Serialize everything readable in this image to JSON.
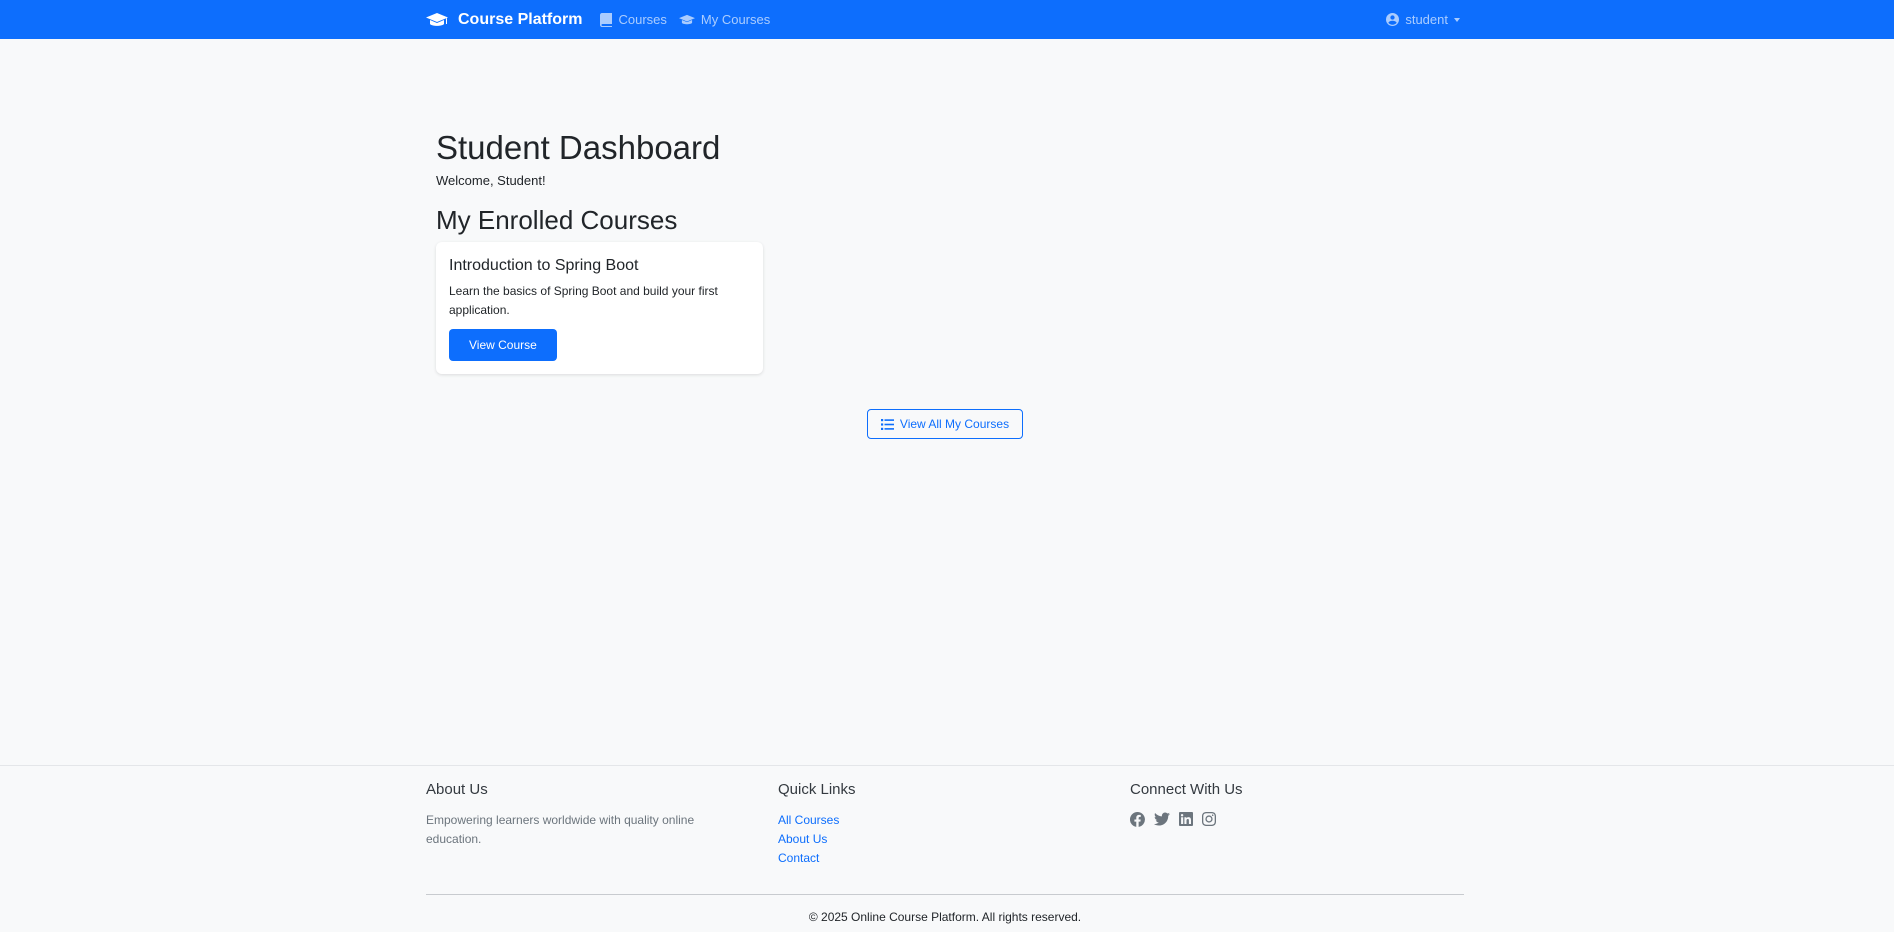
{
  "navbar": {
    "brand": "Course Platform",
    "links": [
      {
        "label": "Courses",
        "icon": "book-icon"
      },
      {
        "label": "My Courses",
        "icon": "graduation-cap-icon"
      }
    ],
    "user": "student",
    "color": "#0d6efd"
  },
  "main": {
    "title": "Student Dashboard",
    "welcome": "Welcome, Student!",
    "enrolled_heading": "My Enrolled Courses",
    "courses": [
      {
        "title": "Introduction to Spring Boot",
        "description": "Learn the basics of Spring Boot and build your first application.",
        "button": "View Course"
      }
    ],
    "view_all_button": "View All My Courses"
  },
  "footer": {
    "about": {
      "heading": "About Us",
      "text": "Empowering learners worldwide with quality online education."
    },
    "quick_links": {
      "heading": "Quick Links",
      "links": [
        "All Courses",
        "About Us",
        "Contact"
      ]
    },
    "connect": {
      "heading": "Connect With Us",
      "icons": [
        "facebook-icon",
        "twitter-icon",
        "linkedin-icon",
        "instagram-icon"
      ]
    },
    "copyright": "© 2025 Online Course Platform. All rights reserved."
  }
}
